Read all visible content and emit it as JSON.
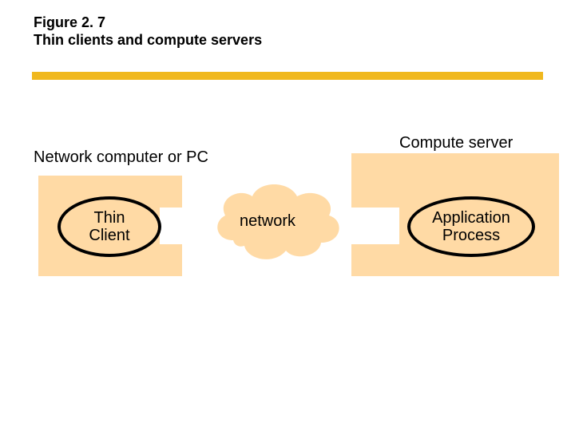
{
  "figure": {
    "number": "Figure 2. 7",
    "title": "Thin clients and compute servers"
  },
  "labels": {
    "left_group": "Network computer or PC",
    "right_group": "Compute server",
    "network": "network"
  },
  "nodes": {
    "thin_client": "Thin\nClient",
    "application_process": "Application\nProcess"
  },
  "colors": {
    "accent": "#f0b81e",
    "panel": "#ffdaa5"
  }
}
